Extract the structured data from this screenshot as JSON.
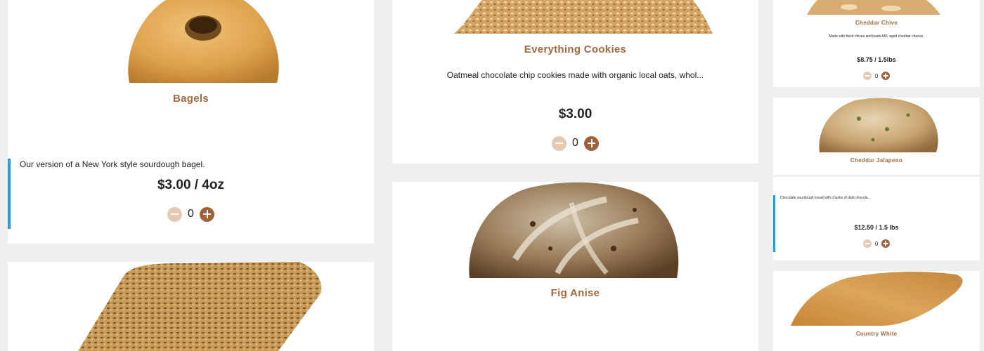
{
  "products": {
    "bagels": {
      "title": "Bagels",
      "description": "Our version of a New York style sourdough bagel.",
      "price": "$3.00 / 4oz",
      "quantity": "0"
    },
    "everything_cookies": {
      "title": "Everything Cookies",
      "description": "Oatmeal chocolate chip cookies made with organic local oats, whol...",
      "price": "$3.00",
      "quantity": "0"
    },
    "fig_anise": {
      "title": "Fig Anise"
    },
    "cheddar_chive": {
      "title": "Cheddar Chive",
      "description": "Made with fresh chives and loads ADL aged cheddar cheese.",
      "price": "$8.75 / 1.5lbs",
      "quantity": "0"
    },
    "cheddar_jalapeno": {
      "title": "Cheddar Jalapeno"
    },
    "chocolate_bread": {
      "description": "Chocolate sourdough bread with chunks of dark chocola...",
      "price": "$12.50 / 1.5 lbs",
      "quantity": "0"
    },
    "country_white": {
      "title": "Country White"
    }
  },
  "colors": {
    "title_brown": "#a26a3f",
    "plus_button": "#a0603a",
    "minus_button": "#e6c9b1",
    "accent_blue": "#2a9be0",
    "background": "#efefef"
  },
  "icons": {
    "minus": "minus-icon",
    "plus": "plus-icon"
  }
}
